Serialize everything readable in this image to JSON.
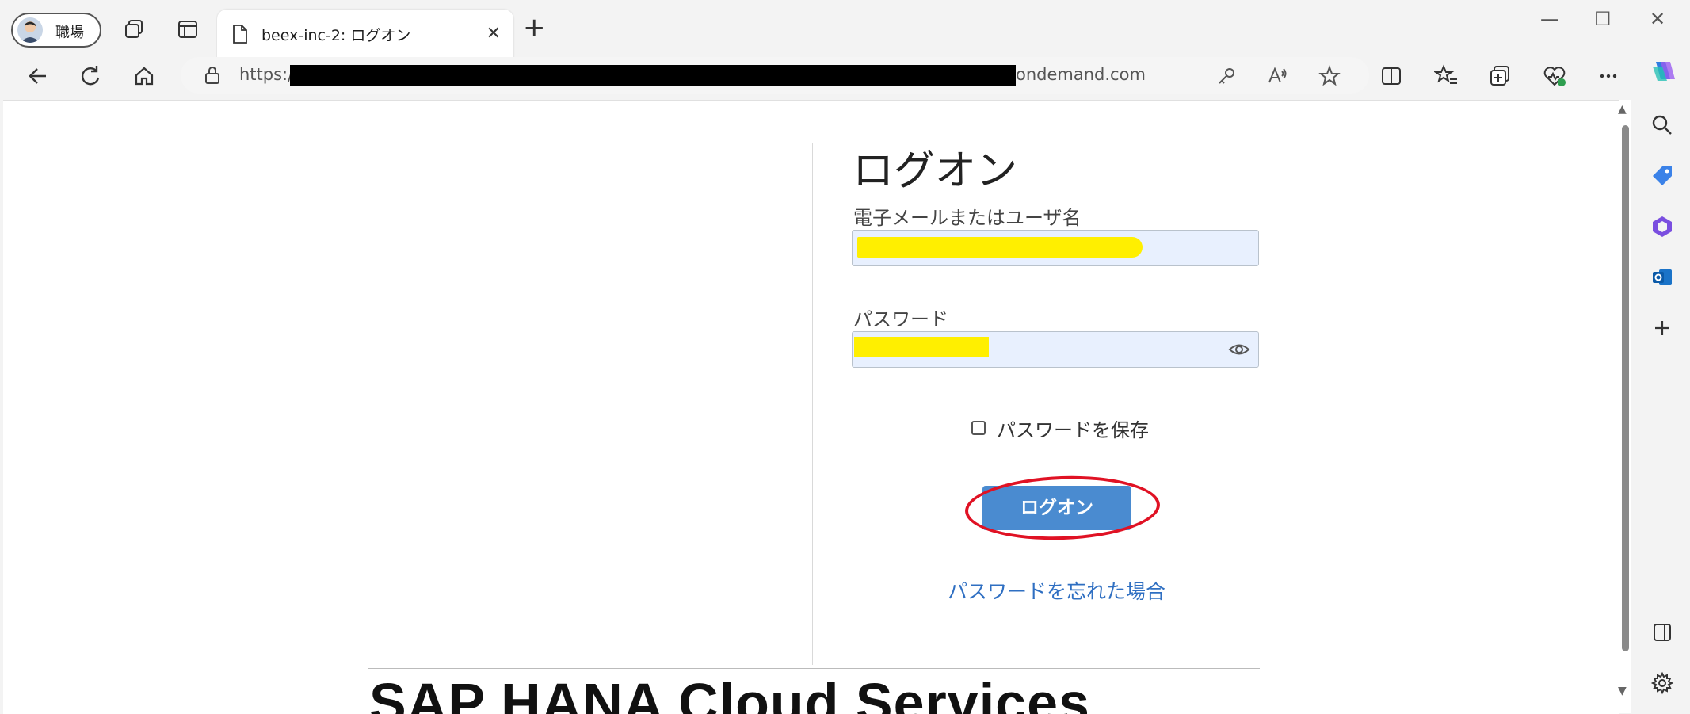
{
  "browser": {
    "profile_label": "職場",
    "tab_title": "beex-inc-2: ログオン",
    "tab_close": "✕",
    "new_tab": "+",
    "window_controls": {
      "minimize": "—",
      "maximize": "☐",
      "close": "✕"
    },
    "address": {
      "scheme": "https:/",
      "host_suffix": "ondemand.com"
    }
  },
  "login": {
    "heading": "ログオン",
    "username_label": "電子メールまたはユーザ名",
    "password_label": "パスワード",
    "remember_label": "パスワードを保存",
    "logon_button": "ログオン",
    "forgot_link": "パスワードを忘れた場合"
  },
  "footer": {
    "brand_text": "SAP HANA Cloud Services"
  },
  "colors": {
    "accent_button": "#4a8bd0",
    "link": "#2f6fc2",
    "highlight": "#ffef00",
    "annotation_circle": "#e01224"
  }
}
